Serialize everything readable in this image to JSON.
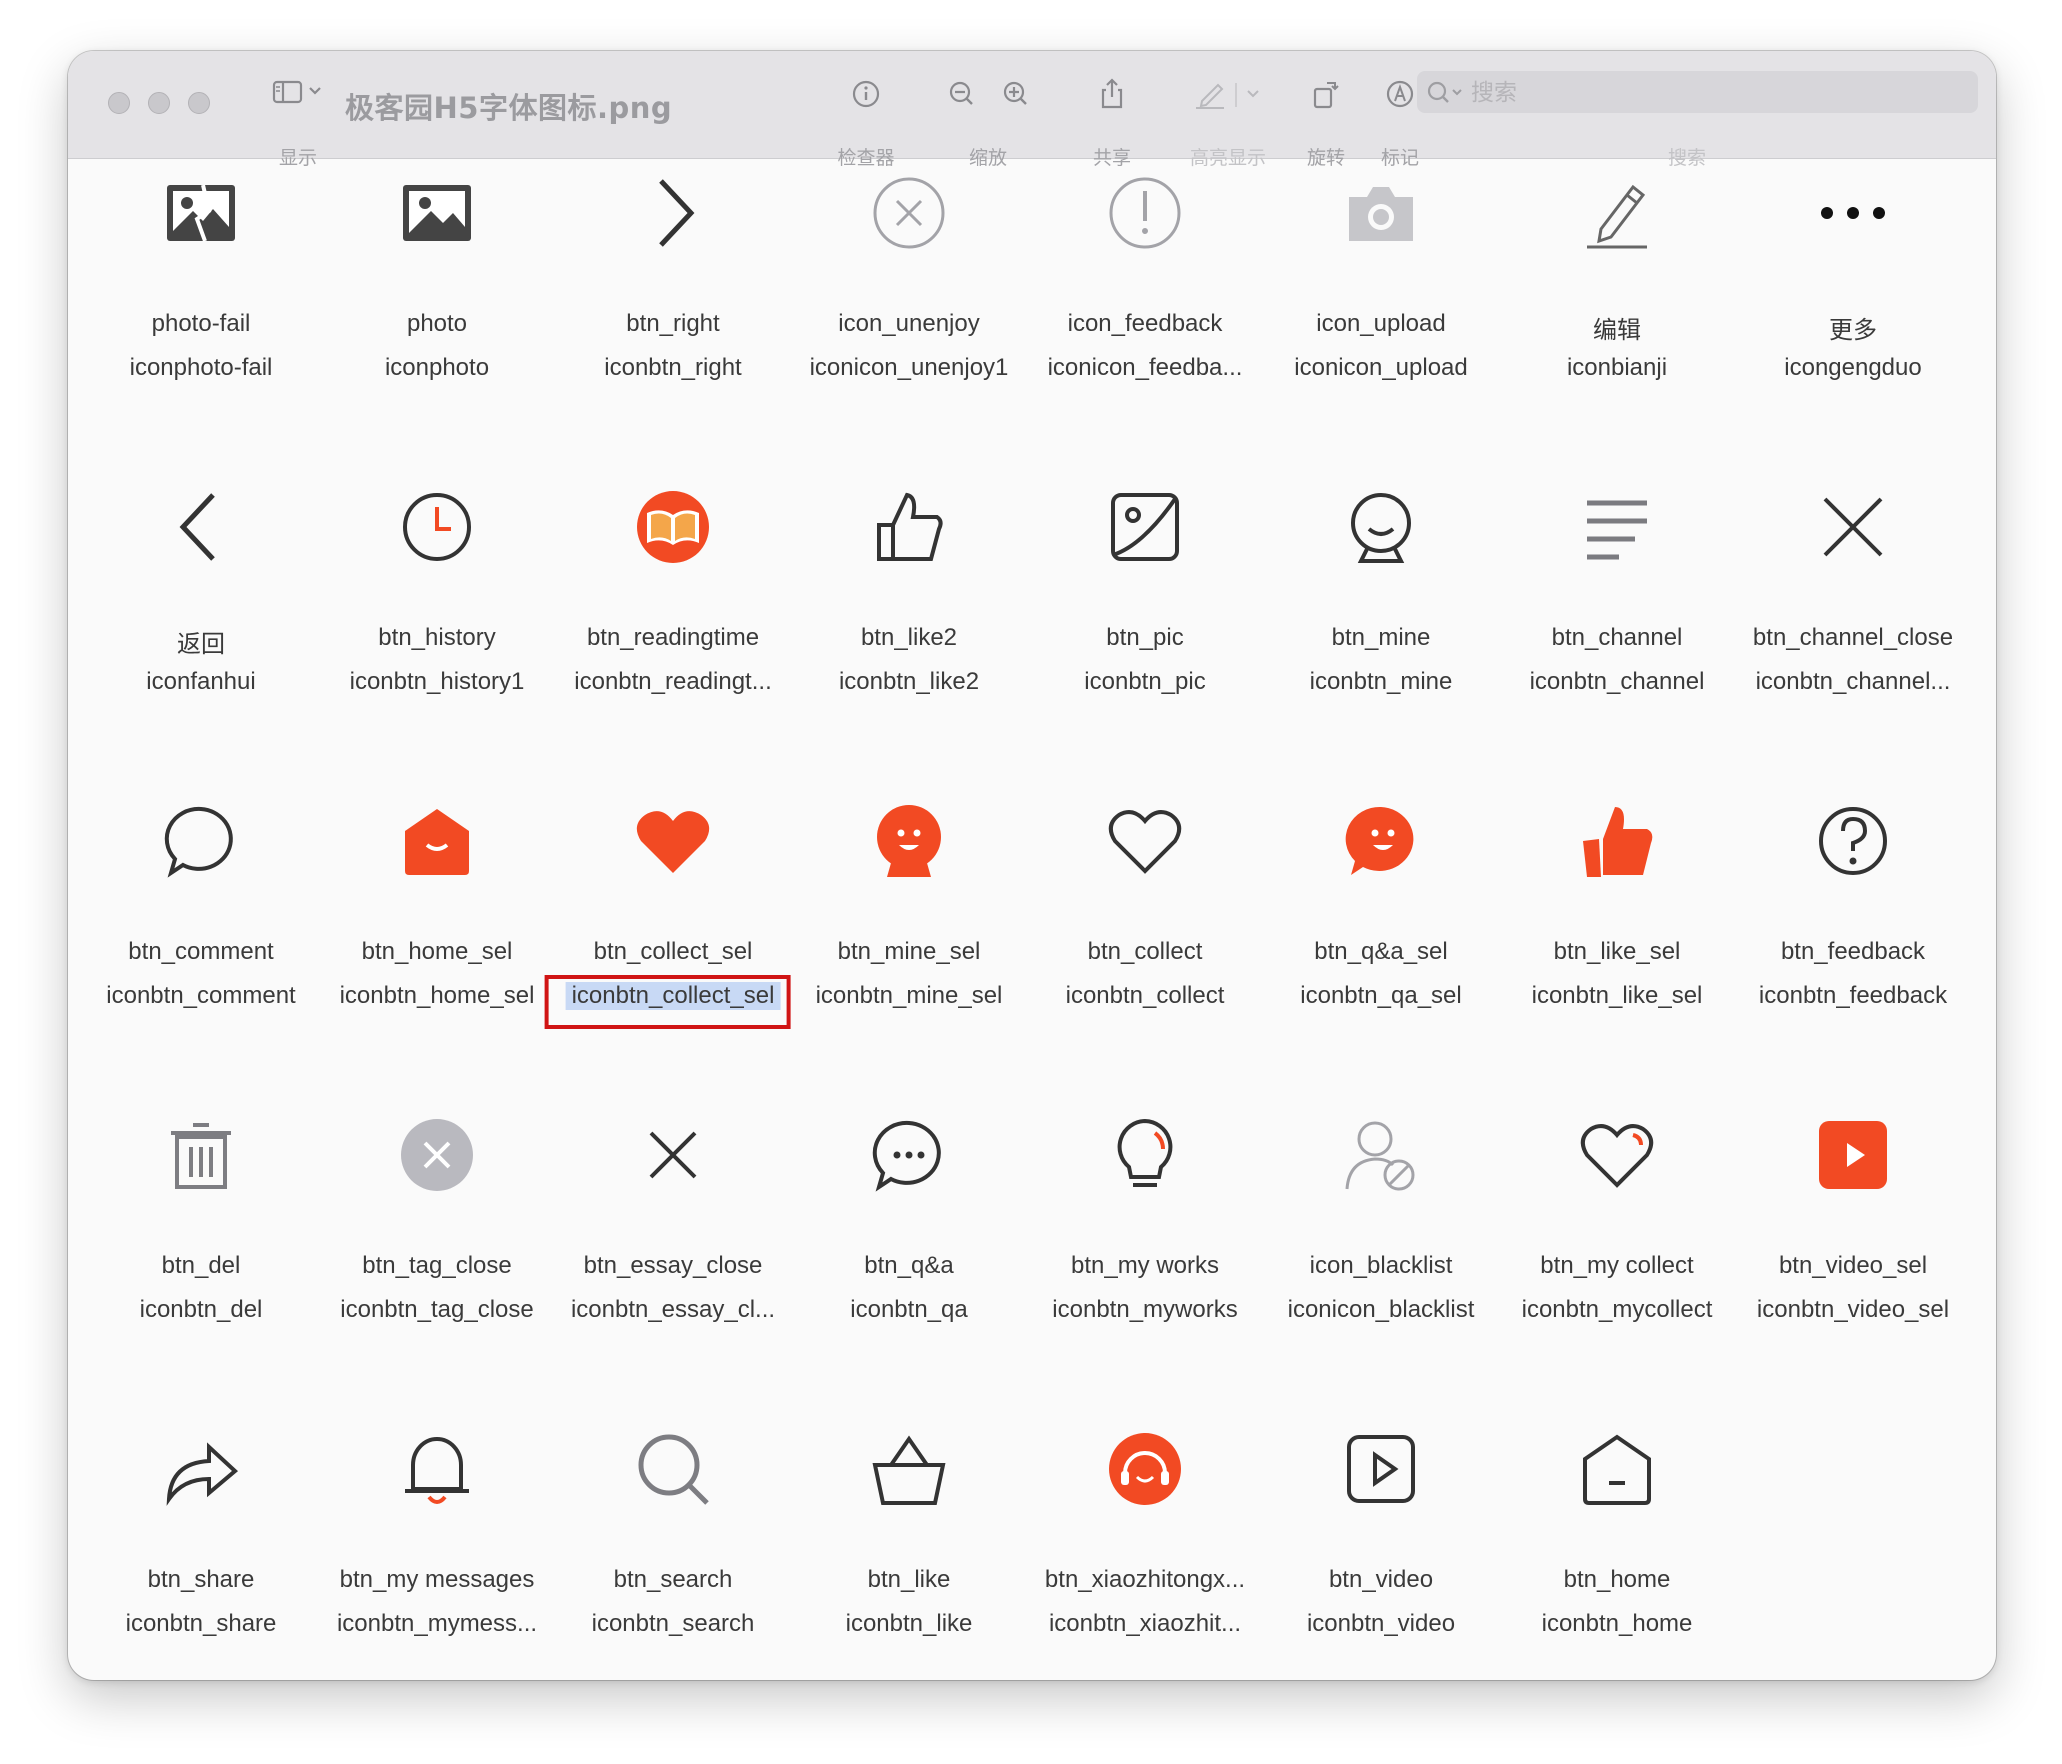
{
  "window": {
    "title": "极客园H5字体图标.png",
    "toolbar": {
      "display_label": "显示",
      "inspector_label": "检查器",
      "zoom_label": "缩放",
      "share_label": "共享",
      "highlight_label": "高亮显示",
      "rotate_label": "旋转",
      "markup_label": "标记",
      "search_caption": "搜索"
    },
    "search": {
      "placeholder": "搜索",
      "value": ""
    }
  },
  "colors": {
    "accent": "#f24a23",
    "icon_dark": "#333333",
    "icon_grey": "#9a9aa0",
    "selection": "#c8d9f5",
    "highlight_box": "#d01414"
  },
  "icons": [
    {
      "name": "photo-fail",
      "code": "iconphoto-fail",
      "icon": "photo-fail-icon"
    },
    {
      "name": "photo",
      "code": "iconphoto",
      "icon": "photo-icon"
    },
    {
      "name": "btn_right",
      "code": "iconbtn_right",
      "icon": "chevron-right-icon"
    },
    {
      "name": "icon_unenjoy",
      "code": "iconicon_unenjoy1",
      "icon": "circle-x-icon"
    },
    {
      "name": "icon_feedback",
      "code": "iconicon_feedba...",
      "icon": "circle-exclamation-icon"
    },
    {
      "name": "icon_upload",
      "code": "iconicon_upload",
      "icon": "camera-icon"
    },
    {
      "name": "编辑",
      "code": "iconbianji",
      "icon": "pencil-icon"
    },
    {
      "name": "更多",
      "code": "icongengduo",
      "icon": "more-dots-icon"
    },
    {
      "name": "返回",
      "code": "iconfanhui",
      "icon": "chevron-left-icon"
    },
    {
      "name": "btn_history",
      "code": "iconbtn_history1",
      "icon": "clock-icon"
    },
    {
      "name": "btn_readingtime",
      "code": "iconbtn_readingt...",
      "icon": "book-icon"
    },
    {
      "name": "btn_like2",
      "code": "iconbtn_like2",
      "icon": "thumb-up-outline-icon"
    },
    {
      "name": "btn_pic",
      "code": "iconbtn_pic",
      "icon": "picture-icon"
    },
    {
      "name": "btn_mine",
      "code": "iconbtn_mine",
      "icon": "face-outline-icon"
    },
    {
      "name": "btn_channel",
      "code": "iconbtn_channel",
      "icon": "menu-lines-icon"
    },
    {
      "name": "btn_channel_close",
      "code": "iconbtn_channel...",
      "icon": "close-icon"
    },
    {
      "name": "btn_comment",
      "code": "iconbtn_comment",
      "icon": "speech-bubble-icon"
    },
    {
      "name": "btn_home_sel",
      "code": "iconbtn_home_sel",
      "icon": "home-filled-icon"
    },
    {
      "name": "btn_collect_sel",
      "code": "iconbtn_collect_sel",
      "icon": "heart-filled-icon"
    },
    {
      "name": "btn_mine_sel",
      "code": "iconbtn_mine_sel",
      "icon": "face-filled-icon"
    },
    {
      "name": "btn_collect",
      "code": "iconbtn_collect",
      "icon": "heart-outline-icon"
    },
    {
      "name": "btn_q&a_sel",
      "code": "iconbtn_qa_sel",
      "icon": "chat-face-filled-icon"
    },
    {
      "name": "btn_like_sel",
      "code": "iconbtn_like_sel",
      "icon": "thumb-up-filled-icon"
    },
    {
      "name": "btn_feedback",
      "code": "iconbtn_feedback",
      "icon": "circle-question-icon"
    },
    {
      "name": "btn_del",
      "code": "iconbtn_del",
      "icon": "trash-icon"
    },
    {
      "name": "btn_tag_close",
      "code": "iconbtn_tag_close",
      "icon": "circle-x-filled-icon"
    },
    {
      "name": "btn_essay_close",
      "code": "iconbtn_essay_cl...",
      "icon": "close-small-icon"
    },
    {
      "name": "btn_q&a",
      "code": "iconbtn_qa",
      "icon": "chat-dots-icon"
    },
    {
      "name": "btn_my works",
      "code": "iconbtn_myworks",
      "icon": "lightbulb-icon"
    },
    {
      "name": "icon_blacklist",
      "code": "iconicon_blacklist",
      "icon": "user-blocked-icon"
    },
    {
      "name": "btn_my collect",
      "code": "iconbtn_mycollect",
      "icon": "heart-accent-icon"
    },
    {
      "name": "btn_video_sel",
      "code": "iconbtn_video_sel",
      "icon": "play-filled-icon"
    },
    {
      "name": "btn_share",
      "code": "iconbtn_share",
      "icon": "share-arrow-icon"
    },
    {
      "name": "btn_my messages",
      "code": "iconbtn_mymess...",
      "icon": "bell-icon"
    },
    {
      "name": "btn_search",
      "code": "iconbtn_search",
      "icon": "search-icon"
    },
    {
      "name": "btn_like",
      "code": "iconbtn_like",
      "icon": "basket-icon"
    },
    {
      "name": "btn_xiaozhitongx...",
      "code": "iconbtn_xiaozhit...",
      "icon": "headset-icon"
    },
    {
      "name": "btn_video",
      "code": "iconbtn_video",
      "icon": "play-outline-icon"
    },
    {
      "name": "btn_home",
      "code": "iconbtn_home",
      "icon": "home-outline-icon"
    }
  ],
  "selected_code": "iconbtn_collect_sel"
}
